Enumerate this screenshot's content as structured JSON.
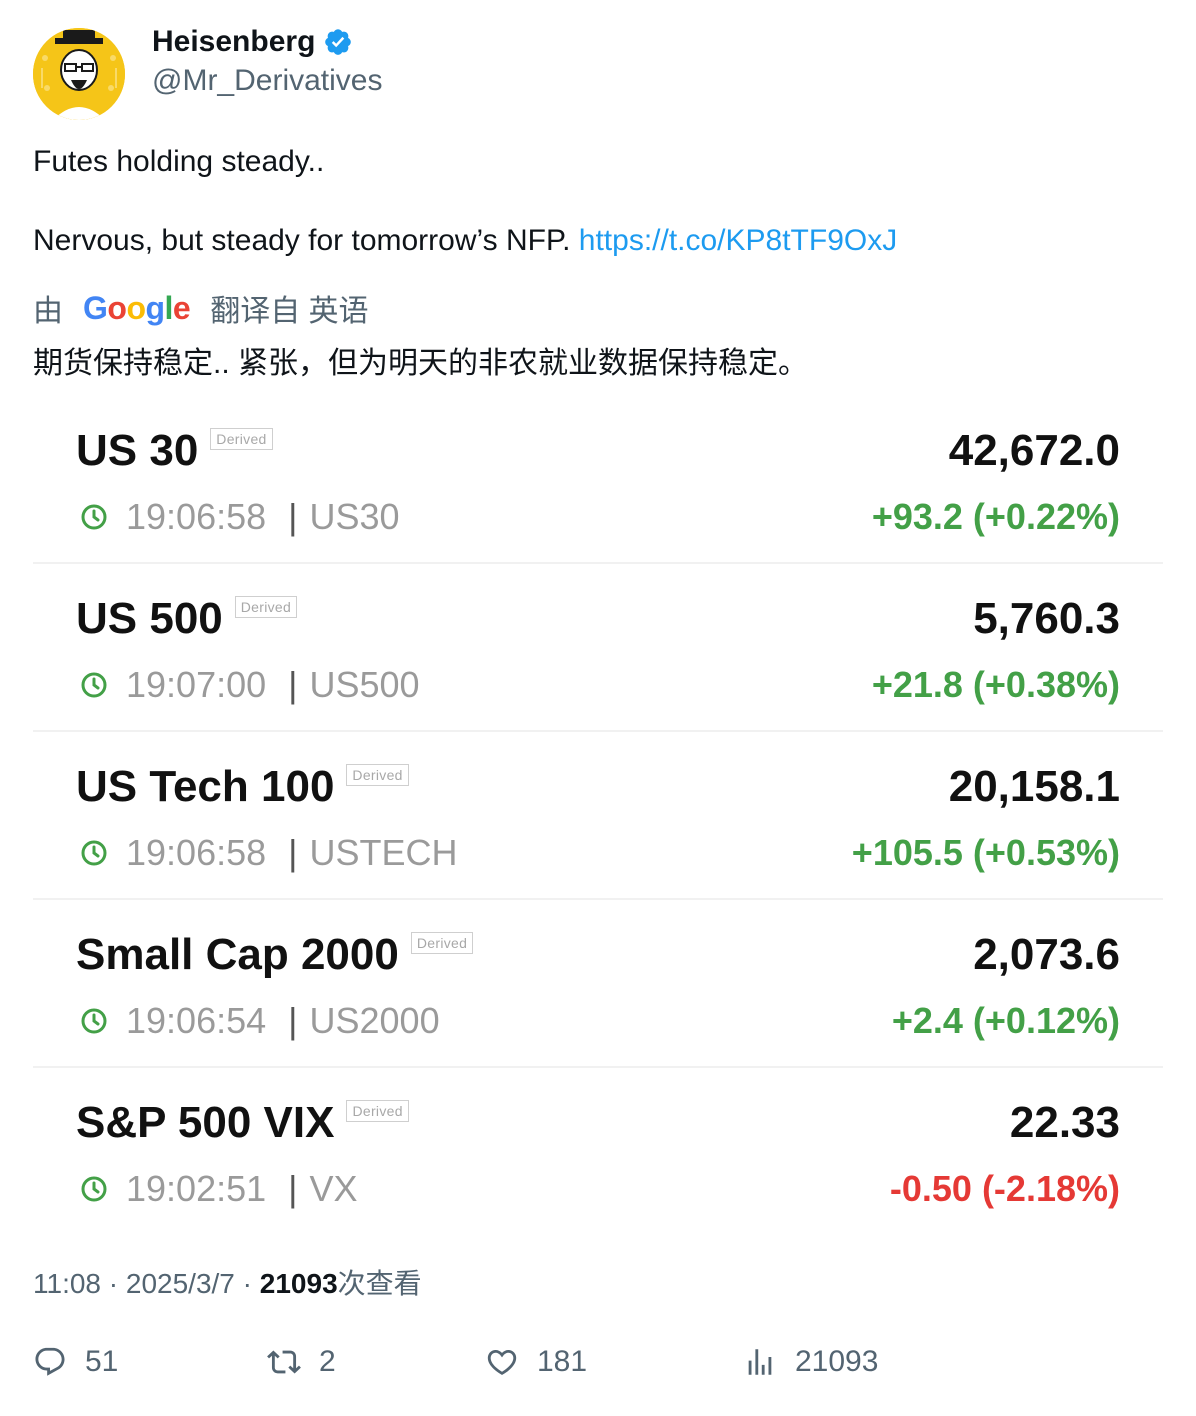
{
  "author": {
    "name": "Heisenberg",
    "handle": "@Mr_Derivatives"
  },
  "tweet": {
    "line1": "Futes holding steady..",
    "line2_text": "Nervous, but steady for tomorrow’s NFP.",
    "link": "https://t.co/KP8tTF9OxJ"
  },
  "translation": {
    "by": "由",
    "google": [
      "G",
      "o",
      "o",
      "g",
      "l",
      "e"
    ],
    "from": "翻译自 英语",
    "text": "期货保持稳定.. 紧张，但为明天的非农就业数据保持稳定。"
  },
  "quotes": [
    {
      "name": "US 30",
      "tag": "Derived",
      "time": "19:06:58",
      "symbol": "US30",
      "price": "42,672.0",
      "change": "+93.2 (+0.22%)",
      "direction": "up"
    },
    {
      "name": "US 500",
      "tag": "Derived",
      "time": "19:07:00",
      "symbol": "US500",
      "price": "5,760.3",
      "change": "+21.8 (+0.38%)",
      "direction": "up"
    },
    {
      "name": "US Tech 100",
      "tag": "Derived",
      "time": "19:06:58",
      "symbol": "USTECH",
      "price": "20,158.1",
      "change": "+105.5 (+0.53%)",
      "direction": "up"
    },
    {
      "name": "Small Cap 2000",
      "tag": "Derived",
      "time": "19:06:54",
      "symbol": "US2000",
      "price": "2,073.6",
      "change": "+2.4 (+0.12%)",
      "direction": "up"
    },
    {
      "name": "S&P 500 VIX",
      "tag": "Derived",
      "time": "19:02:51",
      "symbol": "VX",
      "price": "22.33",
      "change": "-0.50 (-2.18%)",
      "direction": "down"
    }
  ],
  "meta": {
    "time": "11:08",
    "dot": "·",
    "date": "2025/3/7",
    "views_count": "21093",
    "views_suffix": "次查看"
  },
  "actions": {
    "replies": "51",
    "retweets": "2",
    "likes": "181",
    "views": "21093"
  },
  "colors": {
    "link": "#1d9bf0",
    "up": "#43a047",
    "down": "#e53935",
    "verified": "#1d9bf0",
    "google": [
      "#4285F4",
      "#EA4335",
      "#FBBC05",
      "#4285F4",
      "#34A853",
      "#EA4335"
    ]
  },
  "icons": [
    "verified-badge-icon",
    "clock-icon",
    "reply-icon",
    "retweet-icon",
    "like-icon",
    "views-icon"
  ]
}
